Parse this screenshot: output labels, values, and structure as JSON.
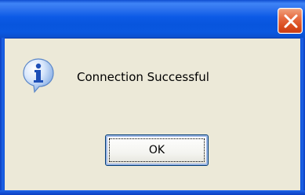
{
  "dialog": {
    "title": "",
    "message": "Connection Successful",
    "icon": "info-icon",
    "ok_label": "OK",
    "close_icon": "close-icon"
  },
  "colors": {
    "titlebar": "#0a58e0",
    "client_bg": "#ece9d8",
    "close_button": "#e05a2c"
  }
}
